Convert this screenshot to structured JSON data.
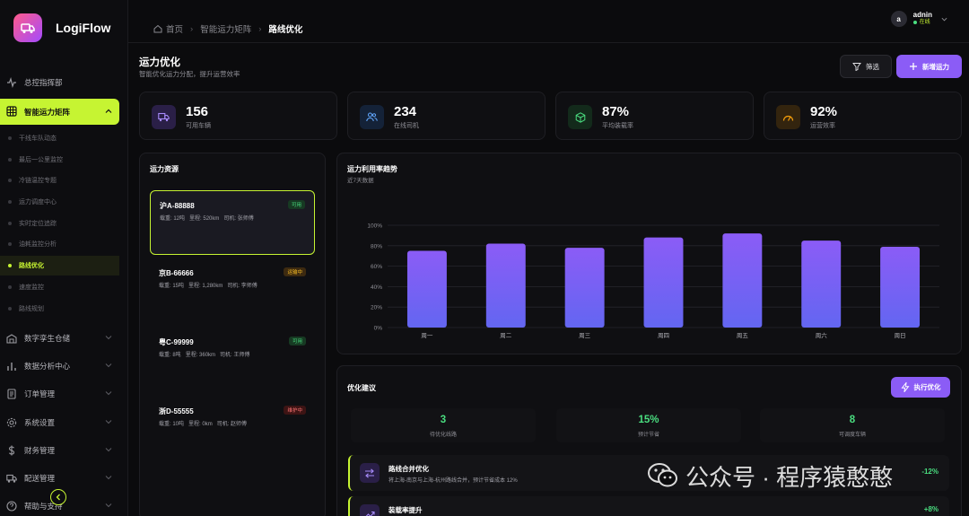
{
  "app": {
    "name": "LogiFlow"
  },
  "sidebar": {
    "items": [
      {
        "label": "总控指挥部"
      },
      {
        "label": "智能运力矩阵"
      },
      {
        "label": "数字孪生仓储"
      },
      {
        "label": "数据分析中心"
      },
      {
        "label": "订单管理"
      },
      {
        "label": "系统设置"
      },
      {
        "label": "财务管理"
      },
      {
        "label": "配送管理"
      },
      {
        "label": "帮助与支持"
      }
    ],
    "subitems": [
      {
        "label": "干线车队动态"
      },
      {
        "label": "最后一公里监控"
      },
      {
        "label": "冷链温控专题"
      },
      {
        "label": "运力调度中心"
      },
      {
        "label": "实时定位追踪"
      },
      {
        "label": "油耗监控分析"
      },
      {
        "label": "路线优化"
      },
      {
        "label": "速度监控"
      },
      {
        "label": "路线规划"
      }
    ]
  },
  "breadcrumb": {
    "home": "首页",
    "parent": "智能运力矩阵",
    "current": "路线优化"
  },
  "user": {
    "avatar_letter": "a",
    "name": "adnin",
    "status": "在线"
  },
  "page": {
    "title": "运力优化",
    "subtitle": "智能优化运力分配，提升运营效率",
    "filter_label": "筛选",
    "add_label": "新增运力"
  },
  "stats": [
    {
      "value": "156",
      "label": "可用车辆",
      "icon": "truck-icon"
    },
    {
      "value": "234",
      "label": "在线司机",
      "icon": "users-icon"
    },
    {
      "value": "87%",
      "label": "平均装载率",
      "icon": "box-icon"
    },
    {
      "value": "92%",
      "label": "运营效率",
      "icon": "gauge-icon"
    }
  ],
  "resources": {
    "title": "运力资源",
    "items": [
      {
        "id": "沪A-88888",
        "status": "可用",
        "load": "载重: 12吨",
        "mileage": "里程: 520km",
        "driver": "司机: 张师傅"
      },
      {
        "id": "京B-66666",
        "status": "运输中",
        "load": "载重: 15吨",
        "mileage": "里程: 1,280km",
        "driver": "司机: 李师傅"
      },
      {
        "id": "粤C-99999",
        "status": "可用",
        "load": "载重: 8吨",
        "mileage": "里程: 360km",
        "driver": "司机: 王师傅"
      },
      {
        "id": "浙D-55555",
        "status": "维护中",
        "load": "载重: 10吨",
        "mileage": "里程: 0km",
        "driver": "司机: 赵师傅"
      }
    ]
  },
  "chart_data": {
    "type": "bar",
    "title": "运力利用率趋势",
    "subtitle": "近7天数据",
    "categories": [
      "周一",
      "周二",
      "周三",
      "周四",
      "周五",
      "周六",
      "周日"
    ],
    "values": [
      75,
      82,
      78,
      88,
      92,
      85,
      79
    ],
    "yticks": [
      "0%",
      "20%",
      "40%",
      "60%",
      "80%",
      "100%"
    ],
    "ylim": [
      0,
      100
    ],
    "grid": true,
    "colors": {
      "top": "#8b5cf6",
      "bottom": "#6366f1"
    }
  },
  "optimization": {
    "title": "优化建议",
    "execute_label": "执行优化",
    "metrics": [
      {
        "value": "3",
        "label": "待优化线路"
      },
      {
        "value": "15%",
        "label": "预计节省"
      },
      {
        "value": "8",
        "label": "可调度车辆"
      }
    ],
    "suggestions": [
      {
        "title": "路线合并优化",
        "desc": "将上海-南京与上海-杭州路线合并，预计节省成本 12%",
        "value": "-12%"
      },
      {
        "title": "装载率提升",
        "desc": "",
        "value": "+8%"
      }
    ]
  },
  "watermark": {
    "text": "公众号 · 程序猿憨憨"
  }
}
